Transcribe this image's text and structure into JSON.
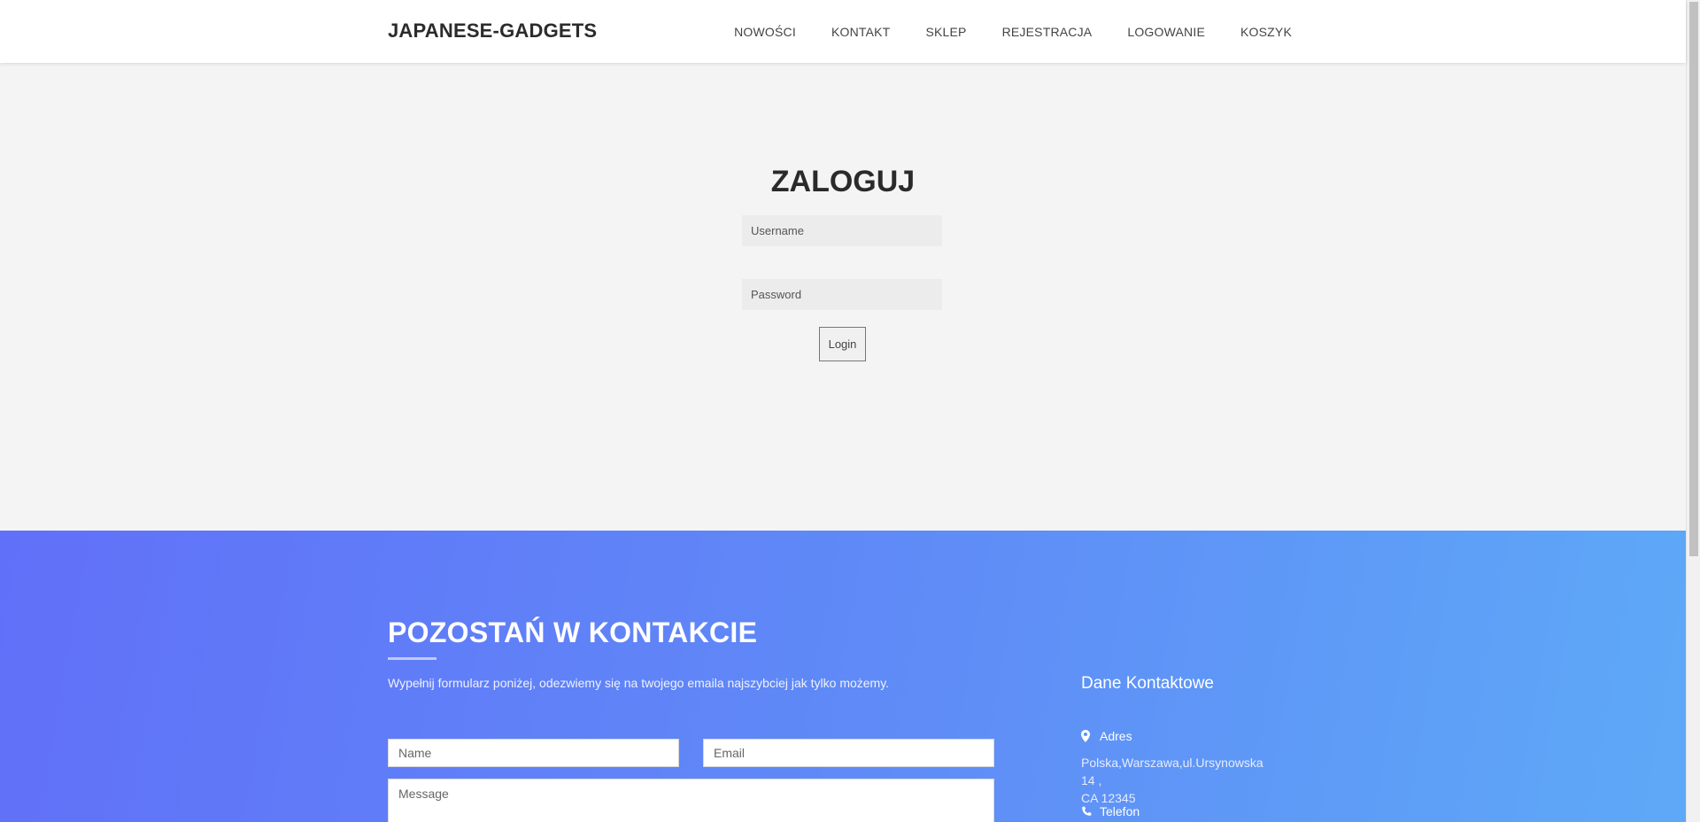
{
  "header": {
    "brand": "JAPANESE-GADGETS",
    "nav": [
      "NOWOŚCI",
      "KONTAKT",
      "SKLEP",
      "REJESTRACJA",
      "LOGOWANIE",
      "KOSZYK"
    ]
  },
  "login": {
    "title": "ZALOGUJ",
    "username_placeholder": "Username",
    "password_placeholder": "Password",
    "button": "Login"
  },
  "contact": {
    "title": "POZOSTAŃ W KONTAKCIE",
    "description": "Wypełnij formularz poniżej, odezwiemy się na twojego emaila najszybciej jak tylko możemy.",
    "name_placeholder": "Name",
    "email_placeholder": "Email",
    "message_placeholder": "Message",
    "info_title": "Dane Kontaktowe",
    "address_label": "Adres",
    "address_line1": "Polska,Warszawa,ul.Ursynowska 14 ,",
    "address_line2": "CA 12345",
    "phone_label": "Telefon"
  },
  "colors": {
    "gradient_start": "#6170f8",
    "gradient_end": "#5ea9f7",
    "page_bg": "#f4f4f4"
  },
  "icons": [
    "map-marker-icon",
    "phone-icon"
  ]
}
